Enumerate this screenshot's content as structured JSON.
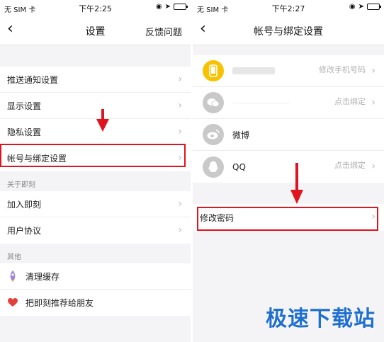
{
  "left": {
    "status": {
      "carrier": "无 SIM 卡",
      "time": "下午2:25"
    },
    "navbar": {
      "back": "‹",
      "title": "设置",
      "action": "反馈问题"
    },
    "group1": [
      {
        "label": "推送通知设置"
      },
      {
        "label": "显示设置"
      },
      {
        "label": "隐私设置"
      },
      {
        "label": "帐号与绑定设置"
      }
    ],
    "section_about": "关于即刻",
    "group2": [
      {
        "label": "加入即刻"
      },
      {
        "label": "用户协议"
      }
    ],
    "section_other": "其他",
    "group3": [
      {
        "label": "清理缓存",
        "icon": "rocket-icon"
      },
      {
        "label": "把即刻推荐给朋友",
        "icon": "heart-icon"
      }
    ]
  },
  "right": {
    "status": {
      "carrier": "无 SIM 卡",
      "time": "下午2:27"
    },
    "navbar": {
      "back": "‹",
      "title": "帐号与绑定设置"
    },
    "accounts": [
      {
        "name": "",
        "action": "修改手机号码",
        "icon": "phone-icon"
      },
      {
        "name": "",
        "action": "点击绑定",
        "icon": "wechat-icon"
      },
      {
        "name": "微博",
        "action": "",
        "icon": "weibo-icon"
      },
      {
        "name": "QQ",
        "action": "点击绑定",
        "icon": "qq-icon"
      }
    ],
    "password": {
      "label": "修改密码"
    }
  },
  "watermark": "极速下载站",
  "colors": {
    "highlight": "#e0141e",
    "watermark": "#1f6fd1",
    "phone_avatar": "#f8c200"
  }
}
